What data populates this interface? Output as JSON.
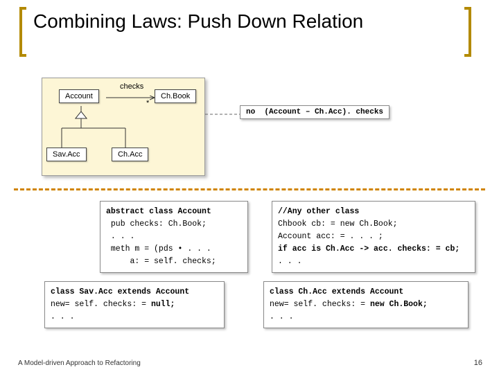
{
  "title": "Combining Laws: Push Down Relation",
  "uml": {
    "checks_label": "checks",
    "star": "*",
    "account": "Account",
    "chbook": "Ch.Book",
    "savacc": "Sav.Acc",
    "chacc": "Ch.Acc"
  },
  "note": "no  (Account – Ch.Acc). checks",
  "code_left": {
    "l1": "abstract class Account",
    "l2": " pub checks: Ch.Book;",
    "l3": " . . .",
    "l4": " meth m = (pds • . . .",
    "l5": "     a: = self. checks;"
  },
  "code_right": {
    "l1": "//Any other class",
    "l2": "Chbook cb: = new Ch.Book;",
    "l3": "Account acc: = . . . ;",
    "l4": "if acc is Ch.Acc -> acc. checks: = cb;",
    "l5": ". . ."
  },
  "code_bl": {
    "l1": "class Sav.Acc extends Account",
    "l2a": "new= self. checks: = ",
    "l2b": "null;",
    "l3": ". . ."
  },
  "code_br": {
    "l1": "class Ch.Acc extends Account",
    "l2a": "new= self. checks: = ",
    "l2b": "new Ch.Book;",
    "l3": ". . ."
  },
  "footer": "A Model-driven Approach to Refactoring",
  "page": "16"
}
